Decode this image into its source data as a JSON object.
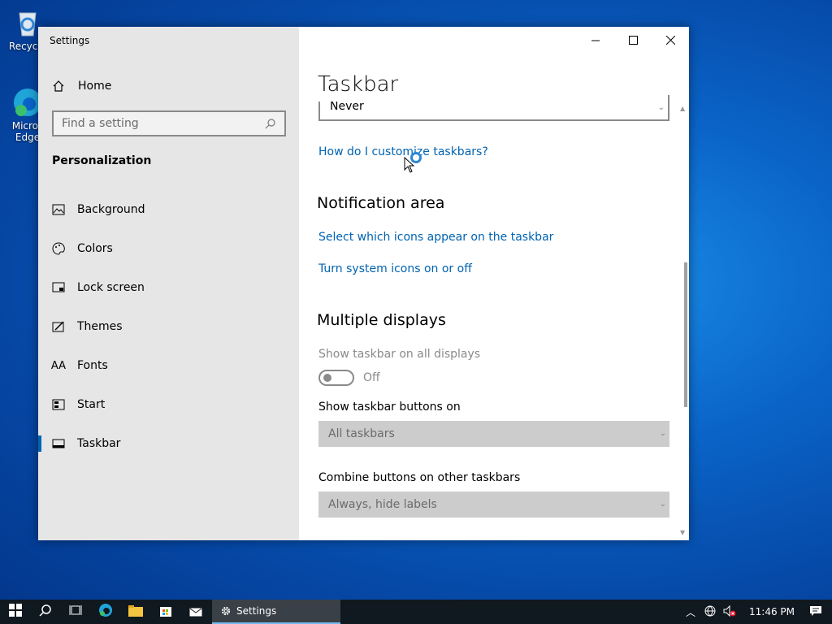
{
  "desktop": {
    "icons": [
      {
        "label": "Recycle",
        "icon": "recycle-bin-icon"
      },
      {
        "label": "Micros Edge",
        "icon": "edge-icon"
      }
    ]
  },
  "window": {
    "title": "Settings",
    "controls": {
      "minimize": "minimize-icon",
      "maximize": "maximize-icon",
      "close": "close-icon"
    }
  },
  "sidebar": {
    "home_label": "Home",
    "search_placeholder": "Find a setting",
    "section": "Personalization",
    "items": [
      {
        "label": "Background",
        "icon": "picture-icon"
      },
      {
        "label": "Colors",
        "icon": "palette-icon"
      },
      {
        "label": "Lock screen",
        "icon": "lock-screen-icon"
      },
      {
        "label": "Themes",
        "icon": "themes-icon"
      },
      {
        "label": "Fonts",
        "icon": "fonts-icon"
      },
      {
        "label": "Start",
        "icon": "start-icon"
      },
      {
        "label": "Taskbar",
        "icon": "taskbar-icon",
        "active": true
      }
    ]
  },
  "content": {
    "title": "Taskbar",
    "partial_dropdown_value": "Never",
    "customize_link": "How do I customize taskbars?",
    "notification_heading": "Notification area",
    "notification_links": [
      "Select which icons appear on the taskbar",
      "Turn system icons on or off"
    ],
    "multi_heading": "Multiple displays",
    "show_all_label": "Show taskbar on all displays",
    "show_all_state": "Off",
    "buttons_on_label": "Show taskbar buttons on",
    "buttons_on_value": "All taskbars",
    "combine_label": "Combine buttons on other taskbars",
    "combine_value": "Always, hide labels"
  },
  "taskbar": {
    "active_app": "Settings",
    "clock": "11:46 PM",
    "colors": {
      "background": "#101820",
      "accent": "#76b9ed"
    }
  },
  "colors": {
    "link": "#0063b1",
    "sidebar_bg": "#e6e6e6",
    "active_bar": "#0063b1"
  }
}
